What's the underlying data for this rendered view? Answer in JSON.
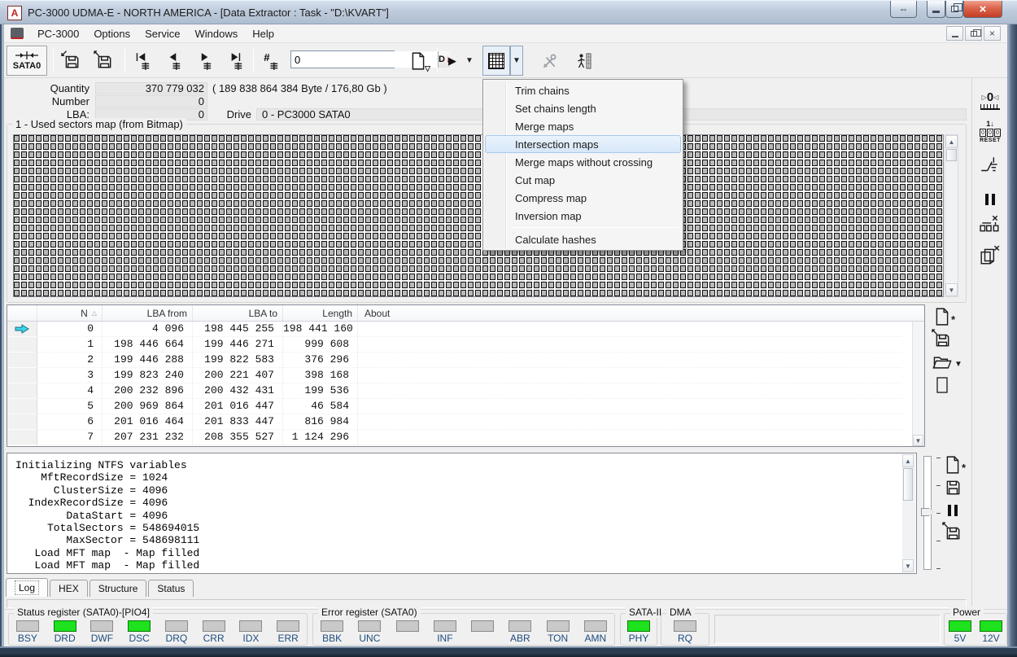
{
  "window": {
    "title": "PC-3000 UDMA-E - NORTH AMERICA - [Data Extractor : Task - \"D:\\KVART\"]"
  },
  "menubar": {
    "items": [
      "PC-3000",
      "Options",
      "Service",
      "Windows",
      "Help"
    ]
  },
  "toolbar": {
    "sata_button_label": "SATA0",
    "sector_number_value": "0",
    "decimal_button_label": "D"
  },
  "info_panel": {
    "quantity_label": "Quantity",
    "quantity_value": "370 779 032",
    "quantity_bytes": "( 189 838 864 384 Byte /  176,80 Gb )",
    "number_label": "Number",
    "number_value": "0",
    "lba_label": "LBA:",
    "lba_value": "0",
    "drive_label": "Drive",
    "drive_value": "0 - PC3000 SATA0"
  },
  "map_panel": {
    "title": "1 - Used sectors map (from Bitmap)"
  },
  "dropdown_menu": {
    "highlighted": "Intersection maps",
    "items": [
      {
        "label": "Trim chains"
      },
      {
        "label": "Set chains length"
      },
      {
        "label": "Merge maps"
      },
      {
        "label": "Intersection maps"
      },
      {
        "label": "Merge maps without crossing"
      },
      {
        "label": "Cut map"
      },
      {
        "label": "Compress map"
      },
      {
        "label": "Inversion map"
      },
      {
        "label": "Calculate hashes",
        "separator_before": true
      }
    ]
  },
  "sector_table": {
    "columns": [
      "N",
      "LBA from",
      "LBA to",
      "Length",
      "About"
    ],
    "current_row": 0,
    "rows": [
      {
        "n": "0",
        "lba_from": "4 096",
        "lba_to": "198 445 255",
        "length": "198 441 160",
        "about": ""
      },
      {
        "n": "1",
        "lba_from": "198 446 664",
        "lba_to": "199 446 271",
        "length": "999 608",
        "about": ""
      },
      {
        "n": "2",
        "lba_from": "199 446 288",
        "lba_to": "199 822 583",
        "length": "376 296",
        "about": ""
      },
      {
        "n": "3",
        "lba_from": "199 823 240",
        "lba_to": "200 221 407",
        "length": "398 168",
        "about": ""
      },
      {
        "n": "4",
        "lba_from": "200 232 896",
        "lba_to": "200 432 431",
        "length": "199 536",
        "about": ""
      },
      {
        "n": "5",
        "lba_from": "200 969 864",
        "lba_to": "201 016 447",
        "length": "46 584",
        "about": ""
      },
      {
        "n": "6",
        "lba_from": "201 016 464",
        "lba_to": "201 833 447",
        "length": "816 984",
        "about": ""
      },
      {
        "n": "7",
        "lba_from": "207 231 232",
        "lba_to": "208 355 527",
        "length": "1 124 296",
        "about": ""
      }
    ]
  },
  "log_panel": {
    "lines": [
      "Initializing NTFS variables",
      "    MftRecordSize = 1024",
      "      ClusterSize = 4096",
      "  IndexRecordSize = 4096",
      "        DataStart = 4096",
      "     TotalSectors = 548694015",
      "        MaxSector = 548698111",
      "   Load MFT map  - Map filled",
      "   Load MFT map  - Map filled"
    ]
  },
  "tabs": {
    "active": "Log",
    "items": [
      "Log",
      "HEX",
      "Structure",
      "Status"
    ]
  },
  "led_panels": {
    "status_register": {
      "title": "Status register (SATA0)-[PIO4]",
      "leds": [
        {
          "label": "BSY",
          "on": false
        },
        {
          "label": "DRD",
          "on": true
        },
        {
          "label": "DWF",
          "on": false
        },
        {
          "label": "DSC",
          "on": true
        },
        {
          "label": "DRQ",
          "on": false
        },
        {
          "label": "CRR",
          "on": false
        },
        {
          "label": "IDX",
          "on": false
        },
        {
          "label": "ERR",
          "on": false
        }
      ]
    },
    "error_register": {
      "title": "Error register (SATA0)",
      "leds": [
        {
          "label": "BBK",
          "on": false
        },
        {
          "label": "UNC",
          "on": false
        },
        {
          "label": "",
          "on": false
        },
        {
          "label": "INF",
          "on": false
        },
        {
          "label": "",
          "on": false
        },
        {
          "label": "ABR",
          "on": false
        },
        {
          "label": "TON",
          "on": false
        },
        {
          "label": "AMN",
          "on": false
        }
      ]
    },
    "sata": {
      "title": "SATA-II",
      "leds": [
        {
          "label": "PHY",
          "on": true
        }
      ]
    },
    "dma": {
      "title": "DMA",
      "leds": [
        {
          "label": "RQ",
          "on": false
        }
      ]
    },
    "power": {
      "title": "Power",
      "leds": [
        {
          "label": "5V",
          "on": true
        },
        {
          "label": "12V",
          "on": true
        }
      ]
    }
  },
  "right_toolbar": {
    "zero_label": "0",
    "reset_top": "1",
    "reset_digits": [
      "0",
      "0",
      "0"
    ],
    "reset_label": "RESET"
  },
  "colors": {
    "led_on": "#1de21d",
    "led_off": "#c9c9c9",
    "menu_highlight_border": "#a9c9ee",
    "titlebar_close": "#d6492f",
    "label_navy": "#1c4a7e"
  }
}
